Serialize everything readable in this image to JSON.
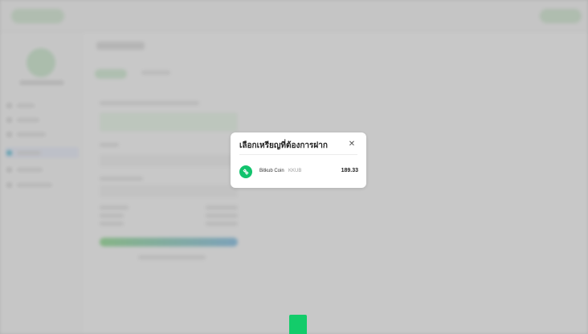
{
  "modal": {
    "title": "เลือกเหรียญที่ต้องการฝาก",
    "close_icon": "close-icon",
    "coins": [
      {
        "name": "Bitkub Coin",
        "symbol": "KKUB",
        "balance": "189.33",
        "icon": "bitkub-coin-icon",
        "color": "#12c36d"
      }
    ]
  },
  "colors": {
    "accent": "#12c36d",
    "overlay": "#bdbdbd"
  }
}
